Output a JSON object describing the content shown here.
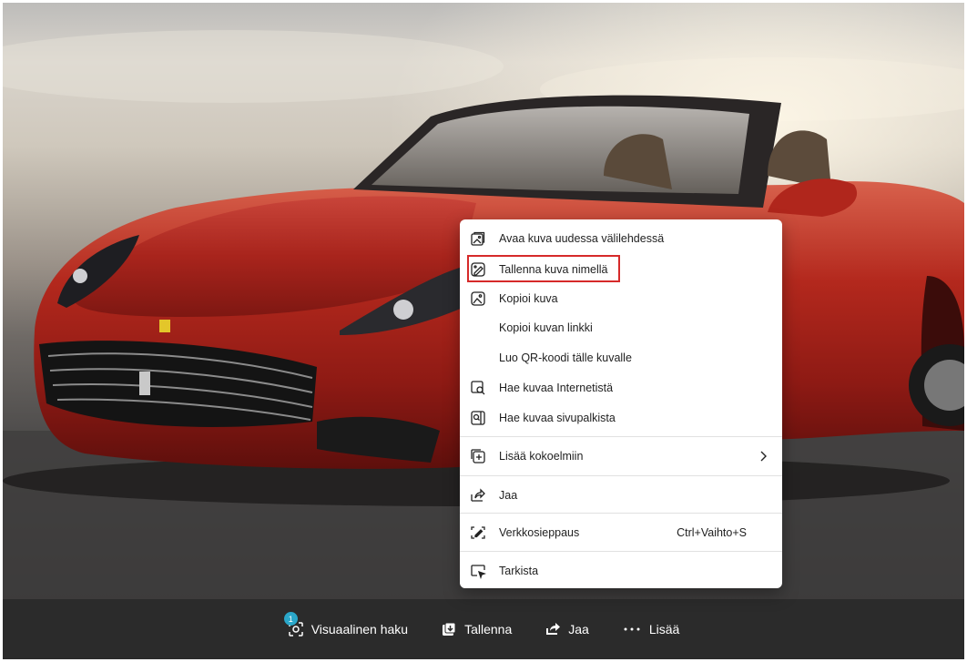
{
  "context_menu": {
    "items": [
      {
        "label": "Avaa kuva uudessa välilehdessä",
        "icon": "open-image-new-tab-icon"
      },
      {
        "label": "Tallenna kuva nimellä",
        "icon": "save-image-as-icon",
        "highlighted": true
      },
      {
        "label": "Kopioi kuva",
        "icon": "copy-image-icon"
      },
      {
        "label": "Kopioi kuvan linkki",
        "icon": ""
      },
      {
        "label": "Luo QR-koodi tälle kuvalle",
        "icon": ""
      },
      {
        "label": "Hae kuvaa Internetistä",
        "icon": "search-image-web-icon"
      },
      {
        "label": "Hae kuvaa sivupalkista",
        "icon": "search-image-sidebar-icon"
      },
      {
        "label": "Lisää kokoelmiin",
        "icon": "add-to-collections-icon",
        "submenu": true
      },
      {
        "label": "Jaa",
        "icon": "share-icon"
      },
      {
        "label": "Verkkosieppaus",
        "icon": "web-capture-icon",
        "shortcut": "Ctrl+Vaihto+S"
      },
      {
        "label": "Tarkista",
        "icon": "inspect-icon"
      }
    ],
    "highlight_color": "#d62a2a"
  },
  "bottom_bar": {
    "visual_search": {
      "label": "Visuaalinen haku",
      "badge": "1",
      "icon": "visual-search-icon"
    },
    "save": {
      "label": "Tallenna",
      "icon": "save-icon"
    },
    "share": {
      "label": "Jaa",
      "icon": "share-icon"
    },
    "more": {
      "label": "Lisää",
      "icon": "more-dots-icon"
    },
    "badge_color": "#2aa7c9",
    "background": "#2b2b2b"
  },
  "image": {
    "subject": "car-photo"
  }
}
